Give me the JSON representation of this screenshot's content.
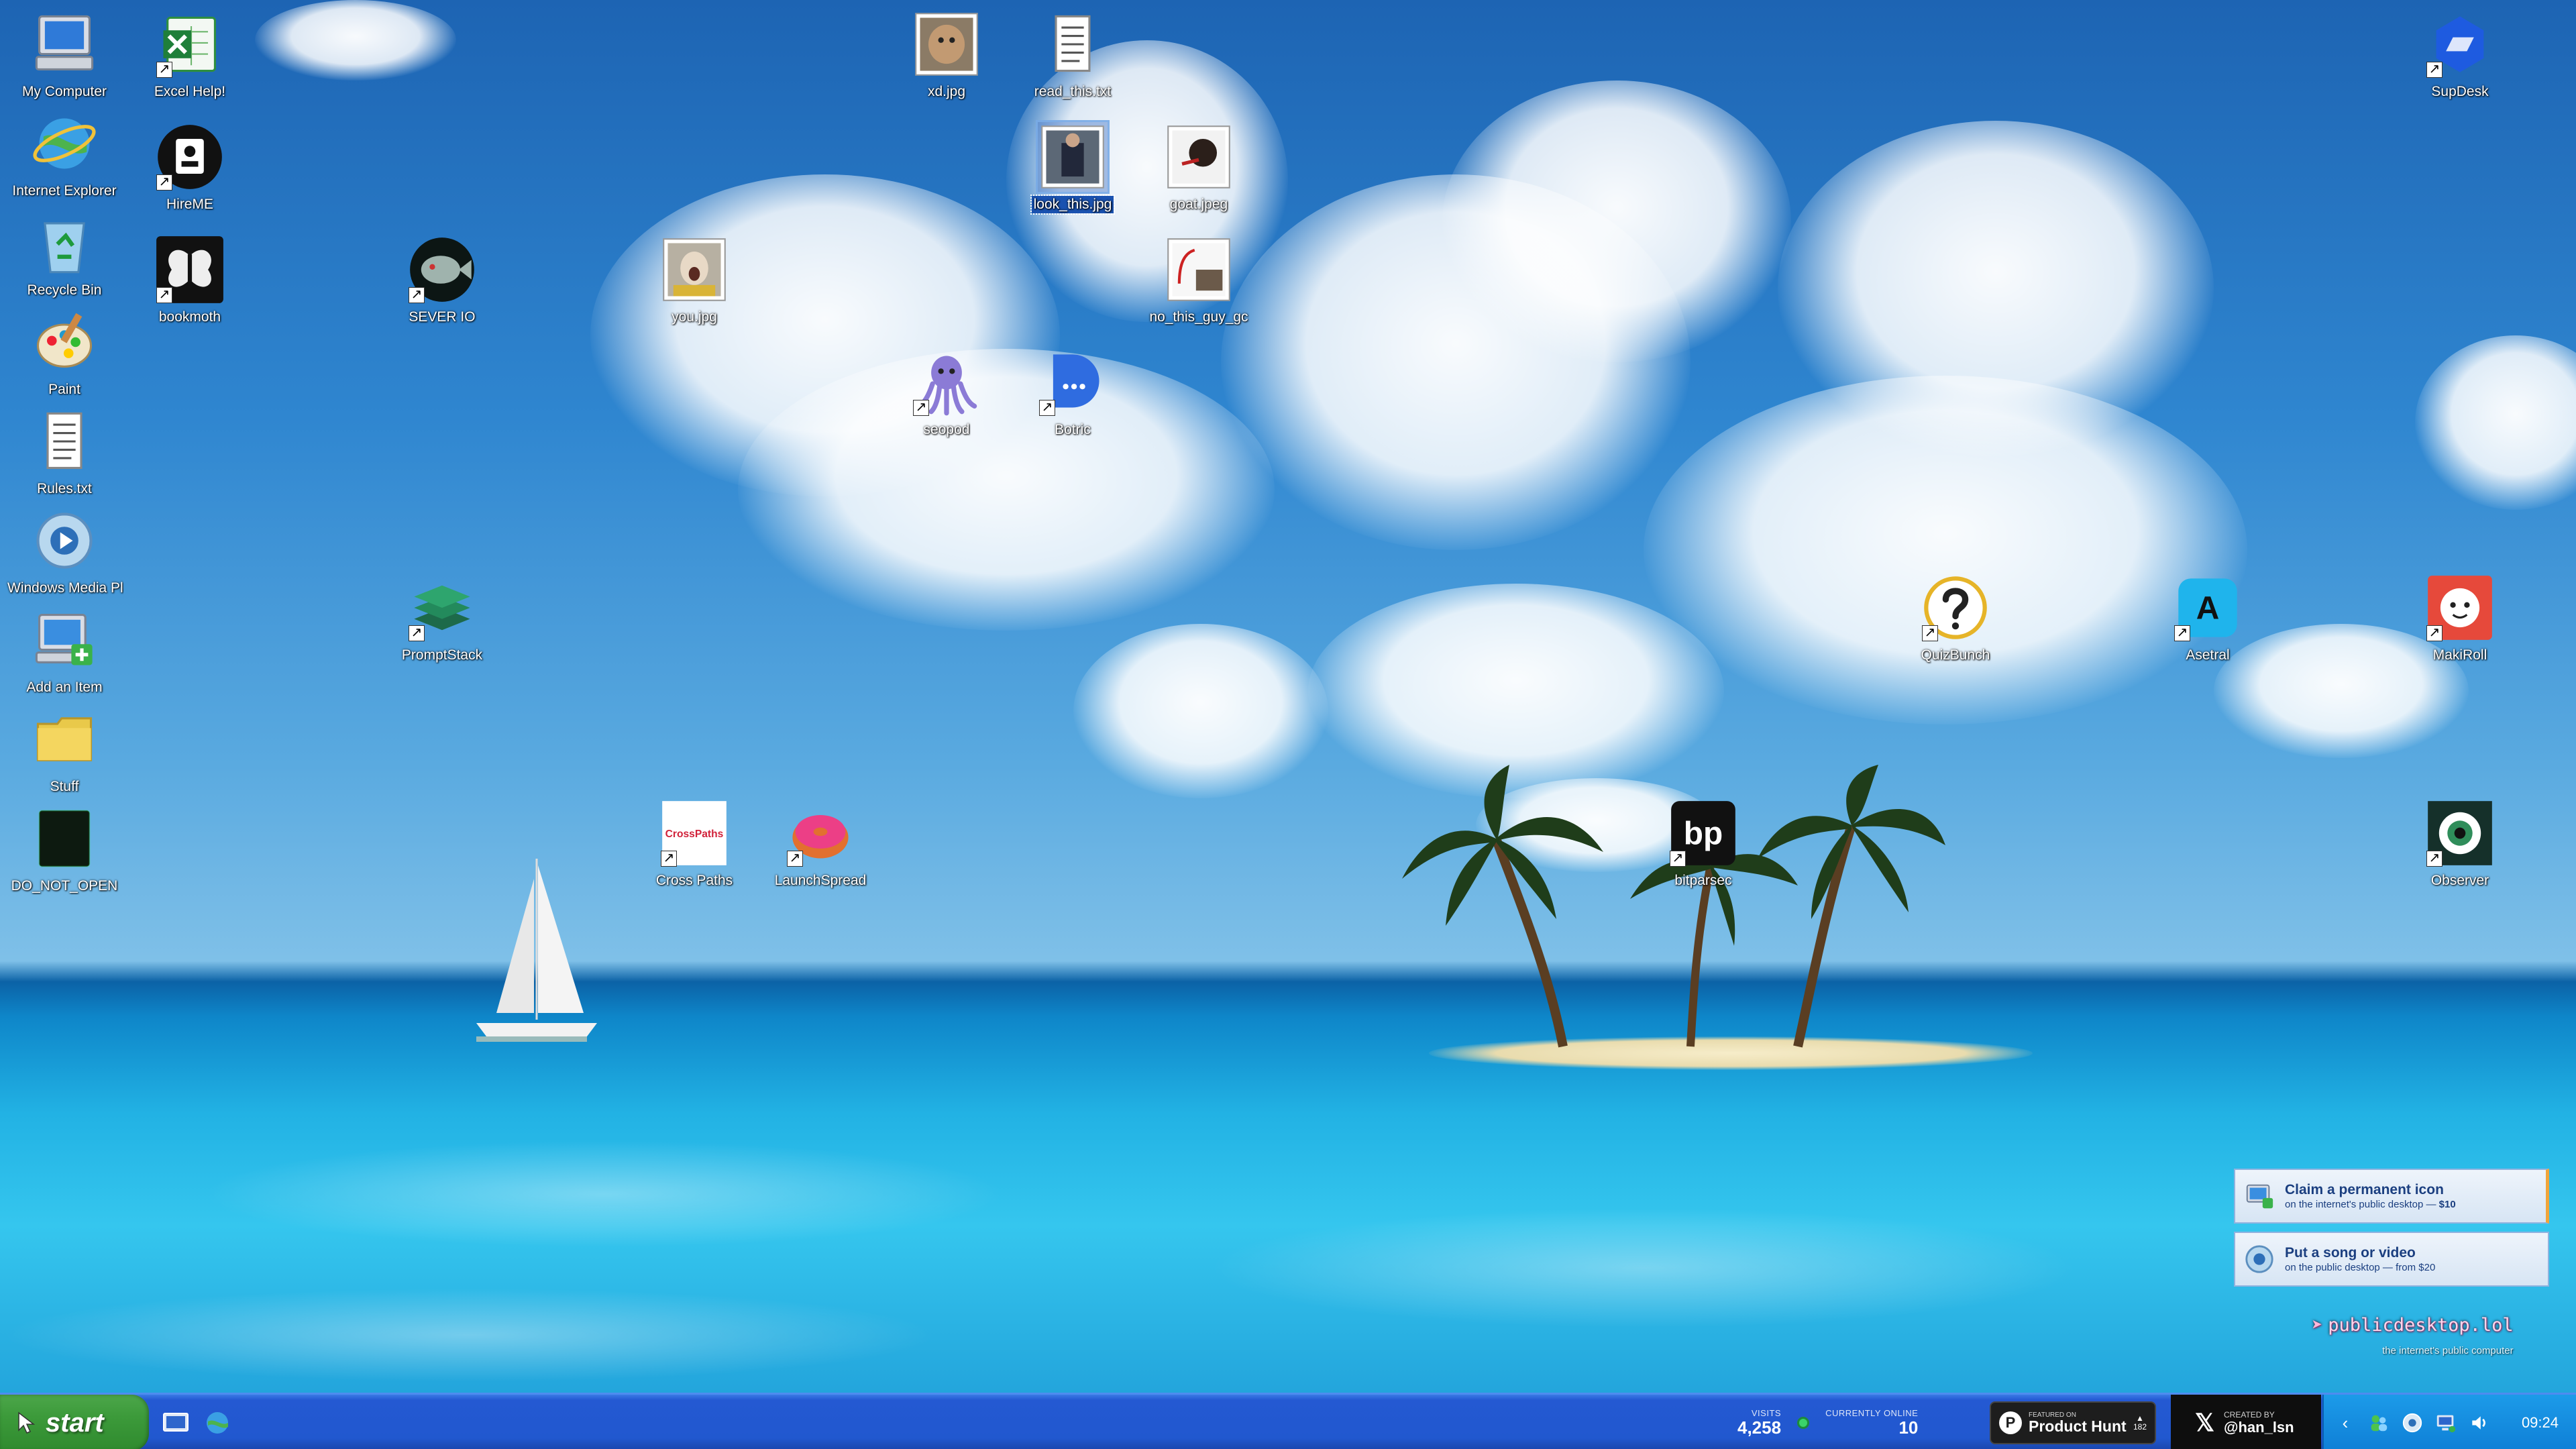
{
  "desktop": {
    "icons": [
      {
        "label": "My Computer",
        "icon": "my-computer-icon",
        "shortcut": false
      },
      {
        "label": "Internet Explorer",
        "icon": "internet-explorer-icon",
        "shortcut": false
      },
      {
        "label": "Recycle Bin",
        "icon": "recycle-bin-icon",
        "shortcut": false
      },
      {
        "label": "Paint",
        "icon": "paint-icon",
        "shortcut": false
      },
      {
        "label": "Rules.txt",
        "icon": "text-file-icon",
        "shortcut": false
      },
      {
        "label": "Windows Media Player",
        "icon": "media-player-icon",
        "shortcut": false
      },
      {
        "label": "Add an Item",
        "icon": "add-item-icon",
        "shortcut": false
      },
      {
        "label": "Stuff",
        "icon": "folder-icon",
        "shortcut": false
      },
      {
        "label": "DO_NOT_OPEN",
        "icon": "black-file-icon",
        "shortcut": false
      },
      {
        "label": "Excel Help!",
        "icon": "excel-icon",
        "shortcut": true
      },
      {
        "label": "HireME",
        "icon": "hireme-icon",
        "shortcut": true
      },
      {
        "label": "bookmoth",
        "icon": "moth-icon",
        "shortcut": true
      },
      {
        "label": "SEVER IO",
        "icon": "fish-icon",
        "shortcut": true
      },
      {
        "label": "you.jpg",
        "icon": "photo-icon",
        "shortcut": false
      },
      {
        "label": "xd.jpg",
        "icon": "photo-icon",
        "shortcut": false
      },
      {
        "label": "read_this.txt",
        "icon": "text-file-icon",
        "shortcut": false
      },
      {
        "label": "look_this.jpg",
        "icon": "photo-icon",
        "shortcut": false,
        "selected": true
      },
      {
        "label": "goat.jpeg",
        "icon": "photo-icon",
        "shortcut": false
      },
      {
        "label": "no_this_guy_gc",
        "icon": "photo-icon",
        "shortcut": false
      },
      {
        "label": "seopod",
        "icon": "octopus-icon",
        "shortcut": true
      },
      {
        "label": "Botric",
        "icon": "chat-bubble-icon",
        "shortcut": true
      },
      {
        "label": "PromptStack",
        "icon": "stack-icon",
        "shortcut": true
      },
      {
        "label": "Cross Paths",
        "icon": "crosspaths-icon",
        "shortcut": true
      },
      {
        "label": "LaunchSpread",
        "icon": "donut-icon",
        "shortcut": true
      },
      {
        "label": "bitparsec",
        "icon": "bp-icon",
        "shortcut": true
      },
      {
        "label": "QuizBunch",
        "icon": "question-icon",
        "shortcut": true
      },
      {
        "label": "Asetral",
        "icon": "letter-a-icon",
        "shortcut": true
      },
      {
        "label": "MakiRoll",
        "icon": "makiroll-icon",
        "shortcut": true
      },
      {
        "label": "SupDesk",
        "icon": "supdesk-icon",
        "shortcut": true
      },
      {
        "label": "Observer",
        "icon": "eye-icon",
        "shortcut": true
      }
    ],
    "crosspaths_logo_text": "CrossPaths",
    "bp_logo_text": "bp",
    "asetral_letter": "A",
    "promos": [
      {
        "title": "Claim a permanent icon",
        "subtitle": "on the internet's public desktop — ",
        "price": "$10"
      },
      {
        "title": "Put a song or video",
        "subtitle": "on the public desktop — from $20",
        "price": ""
      }
    ],
    "brand": {
      "link": "publicdesktop.lol",
      "tagline": "the internet's public computer"
    }
  },
  "taskbar": {
    "start_label": "start",
    "visits_label": "VISITS",
    "visits_value": "4,258",
    "online_label": "CURRENTLY ONLINE",
    "online_value": "10",
    "ph_small": "FEATURED ON",
    "ph_name": "Product Hunt",
    "ph_votes": "182",
    "creator_small": "CREATED BY",
    "creator_handle": "@han_lsn",
    "clock": "09:24"
  },
  "colors": {
    "taskbar": "#2158cf",
    "start": "#3c9a3a",
    "accent": "#f0a53a"
  }
}
